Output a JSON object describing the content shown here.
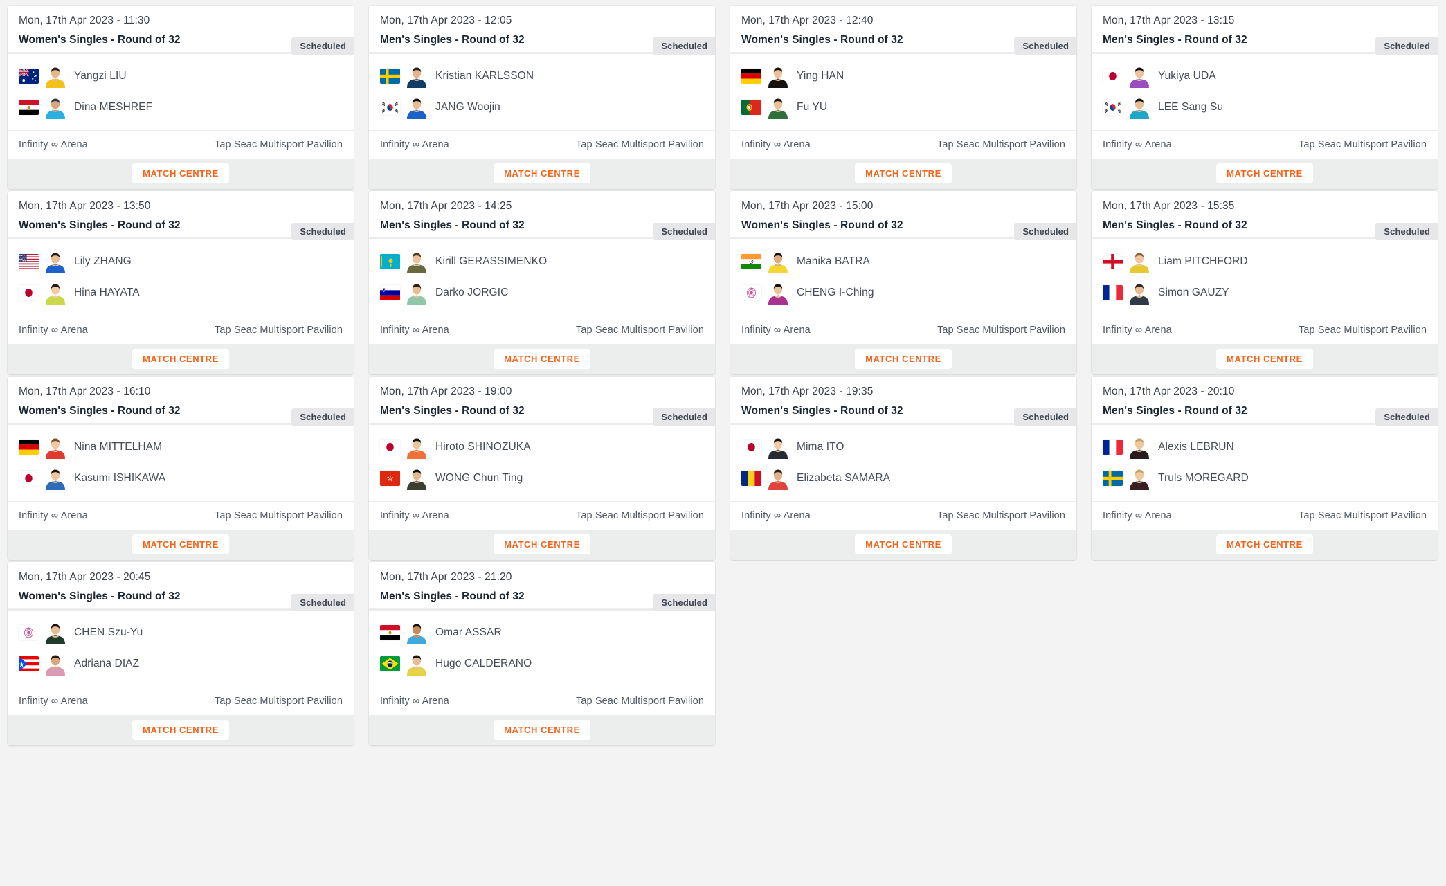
{
  "page": {
    "background_color": "#f3f3f4",
    "accent_color": "#f3641b",
    "badge_bg_color": "#e7e7e9",
    "footer_bg_color": "#eceded"
  },
  "labels": {
    "match_centre": "MATCH CENTRE",
    "status_scheduled": "Scheduled",
    "venue_left": "Infinity ∞ Arena",
    "venue_right": "Tap Seac Multisport Pavilion"
  },
  "matches": [
    {
      "date": "Mon, 17th Apr 2023 - 11:30",
      "event": "Women's Singles - Round of 32",
      "status": "Scheduled",
      "venue_left": "Infinity ∞ Arena",
      "venue_right": "Tap Seac Multisport Pavilion",
      "button": "MATCH CENTRE",
      "players": [
        {
          "name": "Yangzi LIU",
          "flag": "AUS",
          "kit": "#f2c21a",
          "hair": "#2b2118",
          "skin": "#e8b68e"
        },
        {
          "name": "Dina MESHREF",
          "flag": "EGY",
          "kit": "#28b0e0",
          "hair": "#2f3b46",
          "skin": "#dba67a"
        }
      ]
    },
    {
      "date": "Mon, 17th Apr 2023 - 12:05",
      "event": "Men's Singles - Round of 32",
      "status": "Scheduled",
      "venue_left": "Infinity ∞ Arena",
      "venue_right": "Tap Seac Multisport Pavilion",
      "button": "MATCH CENTRE",
      "players": [
        {
          "name": "Kristian KARLSSON",
          "flag": "SWE",
          "kit": "#123c63",
          "hair": "#2b2118",
          "skin": "#e4b391"
        },
        {
          "name": "JANG Woojin",
          "flag": "KOR",
          "kit": "#1d62c8",
          "hair": "#14100d",
          "skin": "#e7bb93"
        }
      ]
    },
    {
      "date": "Mon, 17th Apr 2023 - 12:40",
      "event": "Women's Singles - Round of 32",
      "status": "Scheduled",
      "venue_left": "Infinity ∞ Arena",
      "venue_right": "Tap Seac Multisport Pavilion",
      "button": "MATCH CENTRE",
      "players": [
        {
          "name": "Ying HAN",
          "flag": "GER",
          "kit": "#14110f",
          "hair": "#191310",
          "skin": "#e9c099"
        },
        {
          "name": "Fu YU",
          "flag": "POR",
          "kit": "#2f6f3c",
          "hair": "#1a1410",
          "skin": "#e9c099"
        }
      ]
    },
    {
      "date": "Mon, 17th Apr 2023 - 13:15",
      "event": "Men's Singles - Round of 32",
      "status": "Scheduled",
      "venue_left": "Infinity ∞ Arena",
      "venue_right": "Tap Seac Multisport Pavilion",
      "button": "MATCH CENTRE",
      "players": [
        {
          "name": "Yukiya UDA",
          "flag": "JPN",
          "kit": "#9a4fc0",
          "hair": "#14100d",
          "skin": "#ecc49c"
        },
        {
          "name": "LEE Sang Su",
          "flag": "KOR",
          "kit": "#1fa6c9",
          "hair": "#14100d",
          "skin": "#e7bb93"
        }
      ]
    },
    {
      "date": "Mon, 17th Apr 2023 - 13:50",
      "event": "Women's Singles - Round of 32",
      "status": "Scheduled",
      "venue_left": "Infinity ∞ Arena",
      "venue_right": "Tap Seac Multisport Pavilion",
      "button": "MATCH CENTRE",
      "players": [
        {
          "name": "Lily ZHANG",
          "flag": "USA",
          "kit": "#1d62c8",
          "hair": "#1f1812",
          "skin": "#e9bd93"
        },
        {
          "name": "Hina HAYATA",
          "flag": "JPN",
          "kit": "#c9d94a",
          "hair": "#241b14",
          "skin": "#f0cba4"
        }
      ]
    },
    {
      "date": "Mon, 17th Apr 2023 - 14:25",
      "event": "Men's Singles - Round of 32",
      "status": "Scheduled",
      "venue_left": "Infinity ∞ Arena",
      "venue_right": "Tap Seac Multisport Pavilion",
      "button": "MATCH CENTRE",
      "players": [
        {
          "name": "Kirill GERASSIMENKO",
          "flag": "KAZ",
          "kit": "#67693f",
          "hair": "#4a3524",
          "skin": "#ecc39b"
        },
        {
          "name": "Darko JORGIC",
          "flag": "SLO",
          "kit": "#8fc7a8",
          "hair": "#2b2118",
          "skin": "#e8bd95"
        }
      ]
    },
    {
      "date": "Mon, 17th Apr 2023 - 15:00",
      "event": "Women's Singles - Round of 32",
      "status": "Scheduled",
      "venue_left": "Infinity ∞ Arena",
      "venue_right": "Tap Seac Multisport Pavilion",
      "button": "MATCH CENTRE",
      "players": [
        {
          "name": "Manika BATRA",
          "flag": "IND",
          "kit": "#f2d632",
          "hair": "#14100d",
          "skin": "#e0ab7d"
        },
        {
          "name": "CHENG I-Ching",
          "flag": "TPE",
          "kit": "#a9338f",
          "hair": "#1a1410",
          "skin": "#ecc49c"
        }
      ]
    },
    {
      "date": "Mon, 17th Apr 2023 - 15:35",
      "event": "Men's Singles - Round of 32",
      "status": "Scheduled",
      "venue_left": "Infinity ∞ Arena",
      "venue_right": "Tap Seac Multisport Pavilion",
      "button": "MATCH CENTRE",
      "players": [
        {
          "name": "Liam PITCHFORD",
          "flag": "ENG",
          "kit": "#e8c832",
          "hair": "#8c6233",
          "skin": "#f0c79f"
        },
        {
          "name": "Simon GAUZY",
          "flag": "FRA",
          "kit": "#2f3b46",
          "hair": "#33281d",
          "skin": "#e8bd95"
        }
      ]
    },
    {
      "date": "Mon, 17th Apr 2023 - 16:10",
      "event": "Women's Singles - Round of 32",
      "status": "Scheduled",
      "venue_left": "Infinity ∞ Arena",
      "venue_right": "Tap Seac Multisport Pavilion",
      "button": "MATCH CENTRE",
      "players": [
        {
          "name": "Nina MITTELHAM",
          "flag": "GER",
          "kit": "#e03a31",
          "hair": "#7b4a27",
          "skin": "#f0c79f"
        },
        {
          "name": "Kasumi ISHIKAWA",
          "flag": "JPN",
          "kit": "#2e6bb8",
          "hair": "#1a1410",
          "skin": "#eec5a0"
        }
      ]
    },
    {
      "date": "Mon, 17th Apr 2023 - 19:00",
      "event": "Men's Singles - Round of 32",
      "status": "Scheduled",
      "venue_left": "Infinity ∞ Arena",
      "venue_right": "Tap Seac Multisport Pavilion",
      "button": "MATCH CENTRE",
      "players": [
        {
          "name": "Hiroto SHINOZUKA",
          "flag": "JPN",
          "kit": "#f0713a",
          "hair": "#14100d",
          "skin": "#ecc49c"
        },
        {
          "name": "WONG Chun Ting",
          "flag": "HKG",
          "kit": "#3b4030",
          "hair": "#14100d",
          "skin": "#e5b98f"
        }
      ]
    },
    {
      "date": "Mon, 17th Apr 2023 - 19:35",
      "event": "Women's Singles - Round of 32",
      "status": "Scheduled",
      "venue_left": "Infinity ∞ Arena",
      "venue_right": "Tap Seac Multisport Pavilion",
      "button": "MATCH CENTRE",
      "players": [
        {
          "name": "Mima ITO",
          "flag": "JPN",
          "kit": "#262b33",
          "hair": "#14100d",
          "skin": "#f0cba4"
        },
        {
          "name": "Elizabeta SAMARA",
          "flag": "ROU",
          "kit": "#e0443c",
          "hair": "#2b2118",
          "skin": "#e2b084"
        }
      ]
    },
    {
      "date": "Mon, 17th Apr 2023 - 20:10",
      "event": "Men's Singles - Round of 32",
      "status": "Scheduled",
      "venue_left": "Infinity ∞ Arena",
      "venue_right": "Tap Seac Multisport Pavilion",
      "button": "MATCH CENTRE",
      "players": [
        {
          "name": "Alexis LEBRUN",
          "flag": "FRA",
          "kit": "#2a1c1c",
          "hair": "#caa05e",
          "skin": "#f0c79f"
        },
        {
          "name": "Truls MOREGARD",
          "flag": "SWE",
          "kit": "#3a2020",
          "hair": "#c8a260",
          "skin": "#f0c79f"
        }
      ]
    },
    {
      "date": "Mon, 17th Apr 2023 - 20:45",
      "event": "Women's Singles - Round of 32",
      "status": "Scheduled",
      "venue_left": "Infinity ∞ Arena",
      "venue_right": "Tap Seac Multisport Pavilion",
      "button": "MATCH CENTRE",
      "players": [
        {
          "name": "CHEN Szu-Yu",
          "flag": "TPE",
          "kit": "#1f3b2c",
          "hair": "#14100d",
          "skin": "#e9bd93"
        },
        {
          "name": "Adriana DIAZ",
          "flag": "PUR",
          "kit": "#d99ab4",
          "hair": "#241b14",
          "skin": "#dba67a"
        }
      ]
    },
    {
      "date": "Mon, 17th Apr 2023 - 21:20",
      "event": "Men's Singles - Round of 32",
      "status": "Scheduled",
      "venue_left": "Infinity ∞ Arena",
      "venue_right": "Tap Seac Multisport Pavilion",
      "button": "MATCH CENTRE",
      "players": [
        {
          "name": "Omar ASSAR",
          "flag": "EGY",
          "kit": "#3fa8dd",
          "hair": "#14100d",
          "skin": "#c88d5c"
        },
        {
          "name": "Hugo CALDERANO",
          "flag": "BRA",
          "kit": "#e3d24a",
          "hair": "#1f1812",
          "skin": "#e8bd95"
        }
      ]
    }
  ]
}
